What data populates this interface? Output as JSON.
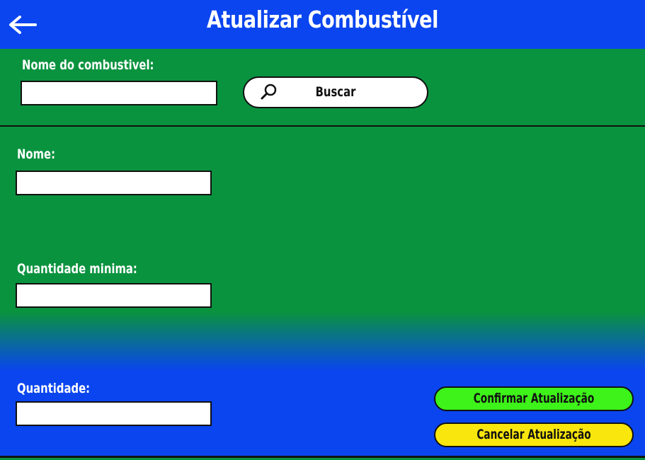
{
  "header": {
    "title": "Atualizar Combustível",
    "back_icon": "arrow-left-icon"
  },
  "search": {
    "label": "Nome do combustivel:",
    "input_value": "",
    "button_label": "Buscar",
    "button_icon": "search-icon"
  },
  "form": {
    "name": {
      "label": "Nome:",
      "value": ""
    },
    "min_quantity": {
      "label": "Quantidade minima:",
      "value": ""
    },
    "quantity": {
      "label": "Quantidade:",
      "value": ""
    }
  },
  "actions": {
    "confirm_label": "Confirmar Atualização",
    "cancel_label": "Cancelar Atualização"
  },
  "colors": {
    "header_bg": "#0a45ef",
    "form_green": "#0a933f",
    "form_blue": "#0a45ef",
    "confirm_bg": "#3df319",
    "cancel_bg": "#f9e60c"
  }
}
